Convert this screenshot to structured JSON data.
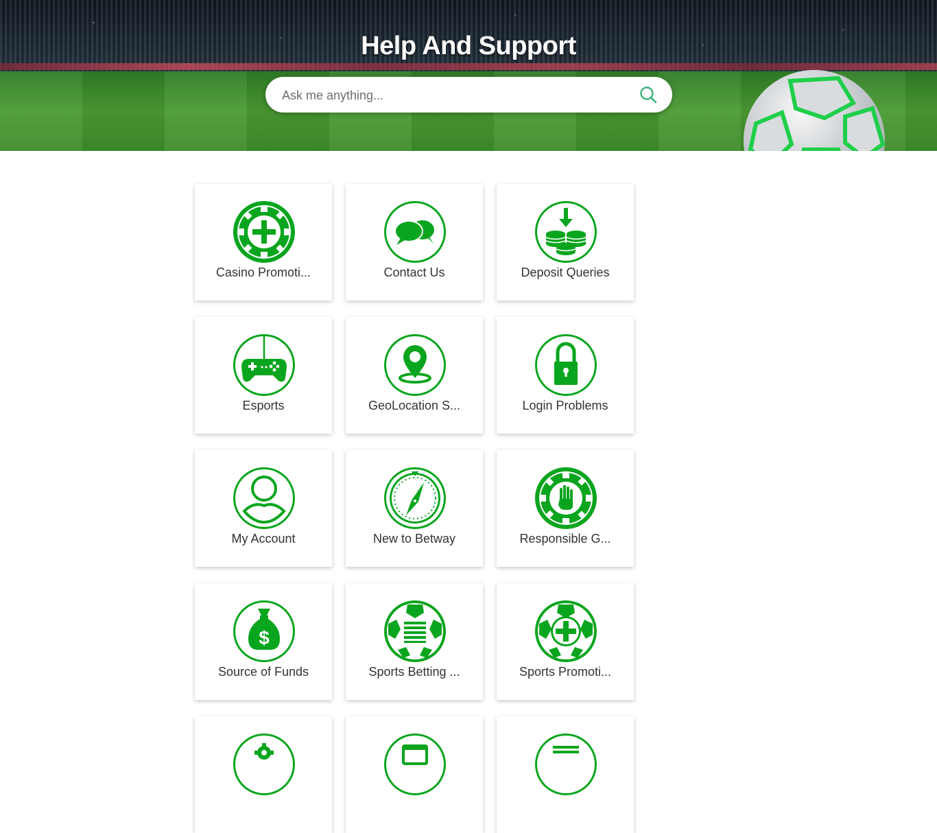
{
  "header": {
    "title": "Help And Support",
    "search_placeholder": "Ask me anything..."
  },
  "colors": {
    "accent_green": "#0aa51e",
    "search_icon": "#3bb27b",
    "label_text": "#333333"
  },
  "categories": [
    {
      "label": "Casino Promoti...",
      "icon": "casino-chip-plus-icon"
    },
    {
      "label": "Contact Us",
      "icon": "chat-bubbles-icon"
    },
    {
      "label": "Deposit Queries",
      "icon": "coins-deposit-icon"
    },
    {
      "label": "Esports",
      "icon": "gamepad-icon"
    },
    {
      "label": "GeoLocation S...",
      "icon": "location-pin-icon"
    },
    {
      "label": "Login Problems",
      "icon": "padlock-icon"
    },
    {
      "label": "My Account",
      "icon": "user-icon"
    },
    {
      "label": "New to Betway",
      "icon": "compass-icon"
    },
    {
      "label": "Responsible G...",
      "icon": "chip-hand-icon"
    },
    {
      "label": "Source of Funds",
      "icon": "money-bag-icon"
    },
    {
      "label": "Sports Betting ...",
      "icon": "ball-document-icon"
    },
    {
      "label": "Sports Promoti...",
      "icon": "ball-plus-icon"
    },
    {
      "label": "",
      "icon": "gear-icon"
    },
    {
      "label": "",
      "icon": "browser-window-icon"
    },
    {
      "label": "",
      "icon": "list-icon"
    }
  ]
}
